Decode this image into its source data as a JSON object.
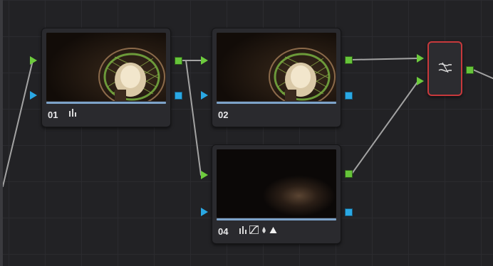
{
  "nodes": {
    "n01": {
      "label": "01",
      "tools": [
        "bars-icon"
      ]
    },
    "n02": {
      "label": "02",
      "tools": []
    },
    "n04": {
      "label": "04",
      "tools": [
        "bars-icon",
        "curves-icon",
        "hsl-qualifier-icon",
        "window-icon"
      ]
    }
  },
  "mixer": {
    "type": "layer-mixer",
    "icon": "mixer-icon",
    "selected": true
  },
  "colors": {
    "rgb_port": "#66c43a",
    "key_port": "#2aa8e4",
    "selection": "#c8393c",
    "progress_bar": "#7da3c9",
    "connection": "#a3a3a3"
  }
}
